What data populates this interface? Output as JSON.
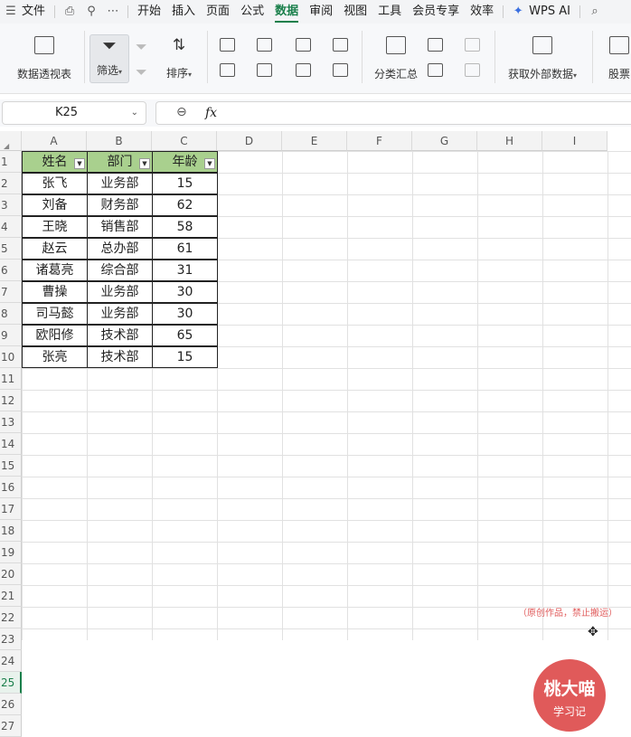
{
  "menubar": {
    "file": "文件",
    "tabs": [
      "开始",
      "插入",
      "页面",
      "公式",
      "数据",
      "审阅",
      "视图",
      "工具",
      "会员专享",
      "效率"
    ],
    "active": "数据",
    "wps_ai": "WPS AI"
  },
  "ribbon": {
    "pivot": "数据透视表",
    "filter": "筛选",
    "sort": "排序",
    "subtotal": "分类汇总",
    "external": "获取外部数据",
    "stock": "股票"
  },
  "formula_bar": {
    "cell_ref": "K25",
    "fx": "fx",
    "content": ""
  },
  "sheet": {
    "columns": [
      "A",
      "B",
      "C",
      "D",
      "E",
      "F",
      "G",
      "H",
      "I"
    ],
    "row_numbers": [
      "1",
      "2",
      "3",
      "4",
      "5",
      "6",
      "7",
      "8",
      "9",
      "10",
      "11",
      "12",
      "13",
      "14",
      "15",
      "16",
      "17",
      "18",
      "19",
      "20",
      "21",
      "22",
      "23",
      "24",
      "25",
      "26",
      "27"
    ],
    "selected_row": "25",
    "header": [
      "姓名",
      "部门",
      "年龄"
    ],
    "rows": [
      [
        "张飞",
        "业务部",
        "15"
      ],
      [
        "刘备",
        "财务部",
        "62"
      ],
      [
        "王晓",
        "销售部",
        "58"
      ],
      [
        "赵云",
        "总办部",
        "61"
      ],
      [
        "诸葛亮",
        "综合部",
        "31"
      ],
      [
        "曹操",
        "业务部",
        "30"
      ],
      [
        "司马懿",
        "业务部",
        "30"
      ],
      [
        "欧阳修",
        "技术部",
        "65"
      ],
      [
        "张亮",
        "技术部",
        "15"
      ]
    ]
  },
  "watermark": {
    "title": "桃大喵",
    "subtitle": "学习记",
    "note": "（原创作品，禁止搬运）"
  },
  "colors": {
    "accent": "#1a7f4b",
    "header_fill": "#a9d08e",
    "watermark": "#e05a5a"
  }
}
